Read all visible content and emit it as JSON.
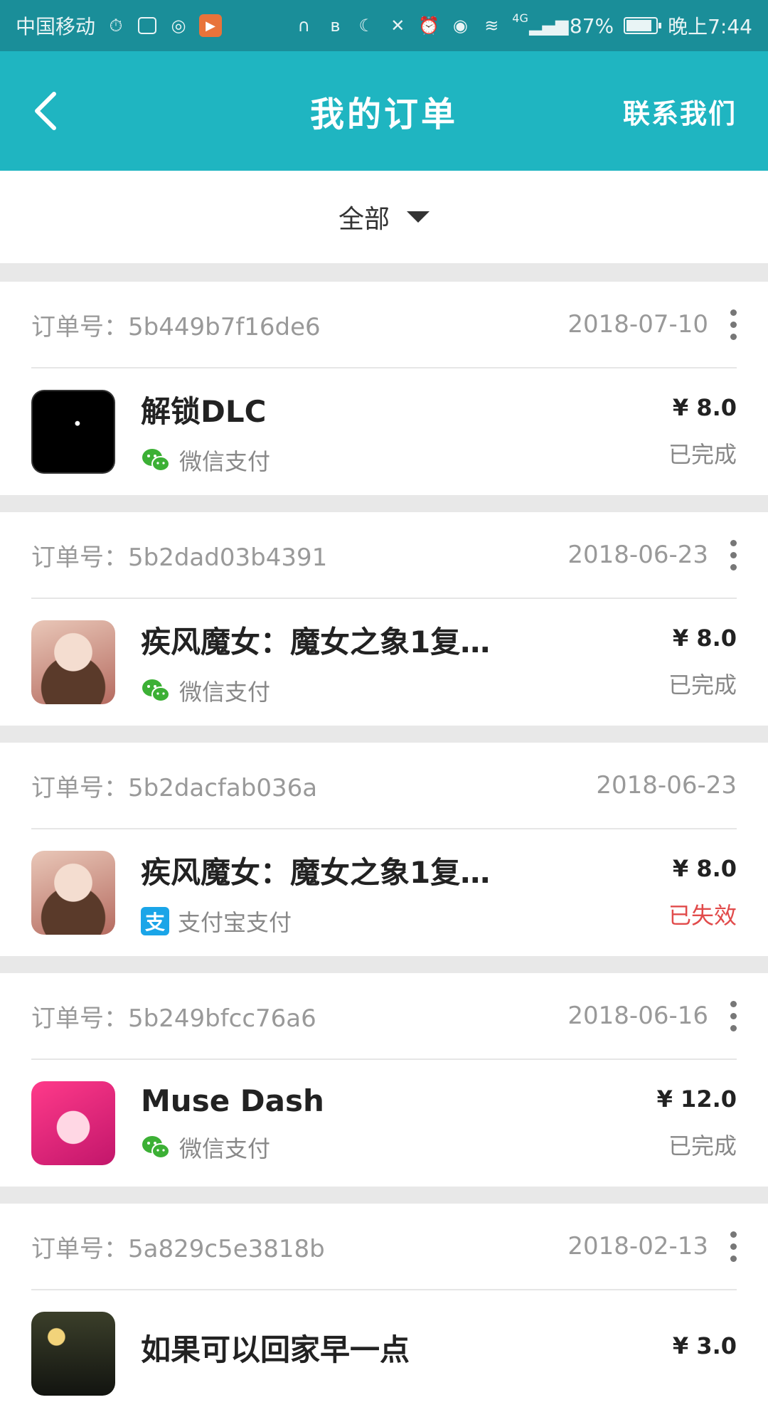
{
  "status_bar": {
    "carrier": "中国移动",
    "network": "4G",
    "battery": "87%",
    "battery_level": 0.87,
    "time": "晚上7:44"
  },
  "header": {
    "title": "我的订单",
    "contact_label": "联系我们"
  },
  "filter": {
    "label": "全部"
  },
  "order_no_prefix": "订单号：",
  "orders": [
    {
      "order_no": "5b449b7f16de6",
      "date": "2018-07-10",
      "name": "解锁DLC",
      "payment": "微信支付",
      "payment_type": "wechat",
      "price": "¥ 8.0",
      "status": "已完成",
      "icon": "dark-character-icon",
      "has_more": true
    },
    {
      "order_no": "5b2dad03b4391",
      "date": "2018-06-23",
      "name": "疾风魔女：魔女之象1复…",
      "payment": "微信支付",
      "payment_type": "wechat",
      "price": "¥ 8.0",
      "status": "已完成",
      "icon": "witch-girl-icon",
      "has_more": true
    },
    {
      "order_no": "5b2dacfab036a",
      "date": "2018-06-23",
      "name": "疾风魔女：魔女之象1复…",
      "payment": "支付宝支付",
      "payment_type": "alipay",
      "price": "¥ 8.0",
      "status": "已失效",
      "icon": "witch-girl-icon",
      "has_more": false
    },
    {
      "order_no": "5b249bfcc76a6",
      "date": "2018-06-16",
      "name": "Muse Dash",
      "payment": "微信支付",
      "payment_type": "wechat",
      "price": "¥ 12.0",
      "status": "已完成",
      "icon": "muse-dash-icon",
      "has_more": true
    },
    {
      "order_no": "5a829c5e3818b",
      "date": "2018-02-13",
      "name": "如果可以回家早一点",
      "payment": "",
      "payment_type": "",
      "price": "¥ 3.0",
      "status": "",
      "icon": "night-scene-icon",
      "has_more": true
    }
  ],
  "colors": {
    "header_bg": "#1fb5c1",
    "status_bar_bg": "#1a8e99",
    "failed_status": "#e14b4b",
    "wechat_green": "#3cb035",
    "alipay_blue": "#1aa5e8"
  }
}
